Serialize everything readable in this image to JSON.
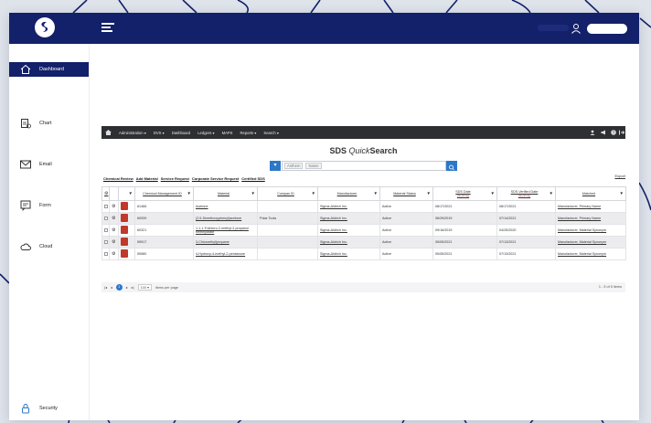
{
  "colors": {
    "navy": "#13206a",
    "accent": "#2c78c8",
    "pdf": "#c0392b"
  },
  "sidebar": {
    "items": [
      {
        "label": "Dashboard",
        "icon": "home-icon",
        "active": true
      },
      {
        "label": "Chart",
        "icon": "chart-icon",
        "active": false
      },
      {
        "label": "Email",
        "icon": "mail-icon",
        "active": false
      },
      {
        "label": "Form",
        "icon": "form-icon",
        "active": false
      },
      {
        "label": "Cloud",
        "icon": "cloud-icon",
        "active": false
      }
    ],
    "bottom": {
      "label": "Security",
      "icon": "lock-icon"
    }
  },
  "appbar": {
    "menu": [
      "Administration ▾",
      "DVS ▾",
      "Dashboard",
      "Ledgers ▾",
      "MAPS",
      "Reports ▾",
      "Search ▾"
    ]
  },
  "main": {
    "title_part1": "SDS ",
    "title_part2": "Quick",
    "title_part3": "Search",
    "search": {
      "chip1": "Anthem",
      "chip2": "Name"
    },
    "links": [
      "Chemical Review",
      "Add Material",
      "Service Request",
      "Corporate Service Request",
      "Certified SDS"
    ],
    "export": "Export"
  },
  "table": {
    "headers": [
      "",
      "",
      "Chemical Management ID",
      "Material",
      "Compan ID",
      "Manufacturer",
      "Material Status",
      "SDS Date",
      "SDS Verified Date",
      "Matched"
    ],
    "subheaders": {
      "sds_date": "(anything)",
      "sds_verified": "(anything)"
    },
    "rows": [
      {
        "id": "61466",
        "material": "Acetone",
        "company_id": "",
        "manufacturer": "Sigma-Aldrich Inc.",
        "status": "Active",
        "sds_date": "08/17/2021",
        "verified": "08/17/2021",
        "matched": "Manufacturer, Primary Name"
      },
      {
        "id": "60939",
        "material": "(2,5-Dimethoxyphenyl)acetone",
        "company_id": "Polar Tools",
        "manufacturer": "Sigma-Aldrich Inc.",
        "status": "Active",
        "sds_date": "06/29/2019",
        "verified": "07/14/2021",
        "matched": "Manufacturer, Primary Name"
      },
      {
        "id": "60321",
        "material": "1,1,1-Trichloro-2-methyl-2-propanol hemihydrate",
        "company_id": "",
        "manufacturer": "Sigma-Aldrich Inc.",
        "status": "Active",
        "sds_date": "09/16/2019",
        "verified": "04/25/2020",
        "matched": "Manufacturer, Material Synonym"
      },
      {
        "id": "59917",
        "material": "3-Chloroethyl)propane",
        "company_id": "",
        "manufacturer": "Sigma-Aldrich Inc.",
        "status": "Active",
        "sds_date": "05/05/2021",
        "verified": "07/13/2021",
        "matched": "Manufacturer, Material Synonym"
      },
      {
        "id": "59580",
        "material": "4-Hydroxy-4-methyl-2-pentanone",
        "company_id": "",
        "manufacturer": "Sigma-Aldrich Inc.",
        "status": "Active",
        "sds_date": "05/05/2021",
        "verified": "07/13/2021",
        "matched": "Manufacturer, Material Synonym"
      }
    ]
  },
  "pager": {
    "current": "1",
    "size": "100 ▾",
    "per_page": "items per page",
    "info": "1 - 5 of 5 items"
  }
}
